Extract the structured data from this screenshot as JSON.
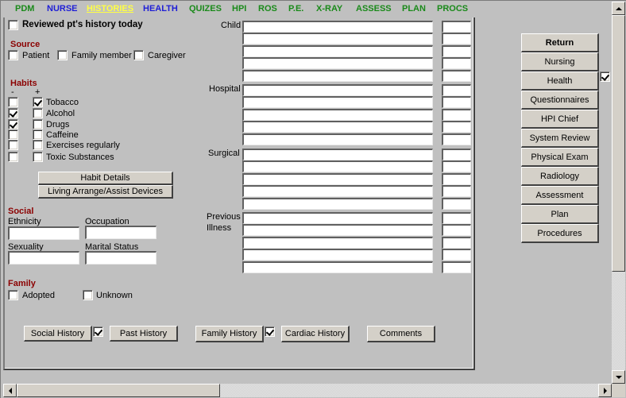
{
  "nav": {
    "items": [
      {
        "label": "PDM",
        "color": "green"
      },
      {
        "label": "NURSE",
        "color": "blue"
      },
      {
        "label": "HISTORIES",
        "color": "yellow",
        "active": true
      },
      {
        "label": "HEALTH",
        "color": "blue"
      },
      {
        "label": "QUIZES",
        "color": "green"
      },
      {
        "label": "HPI",
        "color": "green"
      },
      {
        "label": "ROS",
        "color": "green"
      },
      {
        "label": "P.E.",
        "color": "green"
      },
      {
        "label": "X-RAY",
        "color": "green"
      },
      {
        "label": "ASSESS",
        "color": "green"
      },
      {
        "label": "PLAN",
        "color": "green"
      },
      {
        "label": "PROCS",
        "color": "green"
      }
    ]
  },
  "colors": {
    "nav_green": "#1a8a1a",
    "nav_blue": "#1f1fd6",
    "nav_active": "#ffff44",
    "section_title": "#8b0000",
    "background": "#c0c0c0",
    "button_face": "#d4d0c8"
  },
  "reviewed": {
    "label": "Reviewed pt's history today",
    "checked": false
  },
  "source": {
    "title": "Source",
    "options": [
      {
        "label": "Patient",
        "checked": false
      },
      {
        "label": "Family member",
        "checked": false
      },
      {
        "label": "Caregiver",
        "checked": false
      }
    ]
  },
  "habits": {
    "title": "Habits",
    "minus_header": "-",
    "plus_header": "+",
    "items": [
      {
        "label": "Tobacco",
        "minus": false,
        "plus": true
      },
      {
        "label": "Alcohol",
        "minus": true,
        "plus": false
      },
      {
        "label": "Drugs",
        "minus": true,
        "plus": false
      },
      {
        "label": "Caffeine",
        "minus": false,
        "plus": false
      },
      {
        "label": "Exercises regularly",
        "minus": false,
        "plus": false
      },
      {
        "label": "Toxic Substances",
        "minus": false,
        "plus": false
      }
    ],
    "details_button": "Habit Details",
    "living_button": "Living Arrange/Assist Devices"
  },
  "social": {
    "title": "Social",
    "ethnicity_label": "Ethnicity",
    "ethnicity_value": "",
    "occupation_label": "Occupation",
    "occupation_value": "",
    "sexuality_label": "Sexuality",
    "sexuality_value": "",
    "marital_label": "Marital Status",
    "marital_value": ""
  },
  "family": {
    "title": "Family",
    "adopted_label": "Adopted",
    "adopted_checked": false,
    "unknown_label": "Unknown",
    "unknown_checked": false
  },
  "history_groups": [
    {
      "label": "Child",
      "rows": 5
    },
    {
      "label": "Hospital",
      "rows": 5
    },
    {
      "label": "Surgical",
      "rows": 5
    },
    {
      "label": "Previous\nIllness",
      "label_line1": "Previous",
      "label_line2": "Illness",
      "rows": 5
    }
  ],
  "bottom_buttons": {
    "social_history": "Social History",
    "social_history_checked": true,
    "past_history": "Past History",
    "family_history": "Family History",
    "family_history_checked": true,
    "cardiac_history": "Cardiac History",
    "comments": "Comments"
  },
  "side_buttons": [
    {
      "label": "Return",
      "bold": true
    },
    {
      "label": "Nursing"
    },
    {
      "label": "Health",
      "checked": true
    },
    {
      "label": "Questionnaires"
    },
    {
      "label": "HPI Chief"
    },
    {
      "label": "System Review"
    },
    {
      "label": "Physical Exam"
    },
    {
      "label": "Radiology"
    },
    {
      "label": "Assessment"
    },
    {
      "label": "Plan"
    },
    {
      "label": "Procedures"
    }
  ]
}
